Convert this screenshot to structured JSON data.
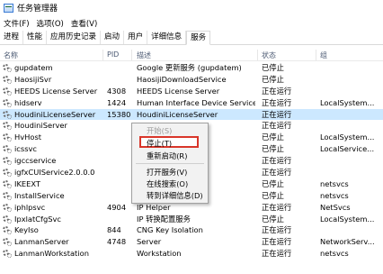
{
  "window": {
    "title": "任务管理器"
  },
  "menu": [
    "文件(F)",
    "选项(O)",
    "查看(V)"
  ],
  "tabs": [
    {
      "label": "进程",
      "active": false
    },
    {
      "label": "性能",
      "active": false
    },
    {
      "label": "应用历史记录",
      "active": false
    },
    {
      "label": "启动",
      "active": false
    },
    {
      "label": "用户",
      "active": false
    },
    {
      "label": "详细信息",
      "active": false
    },
    {
      "label": "服务",
      "active": true
    }
  ],
  "columns": {
    "name": "名称",
    "pid": "PID",
    "desc": "描述",
    "status": "状态",
    "group": "组"
  },
  "rows": [
    {
      "name": "gupdatem",
      "pid": "",
      "desc": "Google 更新服务 (gupdatem)",
      "status": "已停止",
      "group": "",
      "selected": false
    },
    {
      "name": "HaosijiSvr",
      "pid": "",
      "desc": "HaosijiDownloadService",
      "status": "已停止",
      "group": "",
      "selected": false
    },
    {
      "name": "HEEDS License Server",
      "pid": "4308",
      "desc": "HEEDS License Server",
      "status": "正在运行",
      "group": "",
      "selected": false
    },
    {
      "name": "hidserv",
      "pid": "1424",
      "desc": "Human Interface Device Service",
      "status": "正在运行",
      "group": "LocalSystem...",
      "selected": false
    },
    {
      "name": "HoudiniLicenseServer",
      "pid": "15380",
      "desc": "HoudiniLicenseServer",
      "status": "正在运行",
      "group": "",
      "selected": true
    },
    {
      "name": "HoudiniServer",
      "pid": "",
      "desc": "",
      "status": "正在运行",
      "group": "",
      "selected": false
    },
    {
      "name": "HvHost",
      "pid": "",
      "desc": "",
      "status": "已停止",
      "group": "LocalSystem...",
      "selected": false
    },
    {
      "name": "icssvc",
      "pid": "",
      "desc": "",
      "status": "已停止",
      "group": "LocalService...",
      "selected": false
    },
    {
      "name": "igccservice",
      "pid": "",
      "desc": "mmand Cent...",
      "status": "正在运行",
      "group": "",
      "selected": false
    },
    {
      "name": "igfxCUIService2.0.0.0",
      "pid": "",
      "desc": "",
      "status": "正在运行",
      "group": "",
      "selected": false
    },
    {
      "name": "IKEEXT",
      "pid": "",
      "desc": "IP Keying Mo...",
      "status": "已停止",
      "group": "netsvcs",
      "selected": false
    },
    {
      "name": "InstallService",
      "pid": "",
      "desc": "",
      "status": "已停止",
      "group": "netsvcs",
      "selected": false
    },
    {
      "name": "iphlpsvc",
      "pid": "4904",
      "desc": "IP Helper",
      "status": "正在运行",
      "group": "NetSvcs",
      "selected": false
    },
    {
      "name": "IpxlatCfgSvc",
      "pid": "",
      "desc": "IP 转换配置服务",
      "status": "已停止",
      "group": "LocalSystem...",
      "selected": false
    },
    {
      "name": "KeyIso",
      "pid": "844",
      "desc": "CNG Key Isolation",
      "status": "正在运行",
      "group": "",
      "selected": false
    },
    {
      "name": "LanmanServer",
      "pid": "4748",
      "desc": "Server",
      "status": "正在运行",
      "group": "NetworkServ...",
      "selected": false
    },
    {
      "name": "LanmanWorkstation",
      "pid": "",
      "desc": "Workstation",
      "status": "正在运行",
      "group": "netsvcs",
      "selected": false
    }
  ],
  "context_menu": {
    "start": "开始(S)",
    "stop": "停止(T)",
    "restart": "重新启动(R)",
    "open_services": "打开服务(V)",
    "search_online": "在线搜索(O)",
    "go_to_details": "转到详细信息(D)"
  },
  "colors": {
    "selection": "#cce8ff",
    "highlight_border": "#d9362a",
    "header_text": "#4c5a73"
  }
}
